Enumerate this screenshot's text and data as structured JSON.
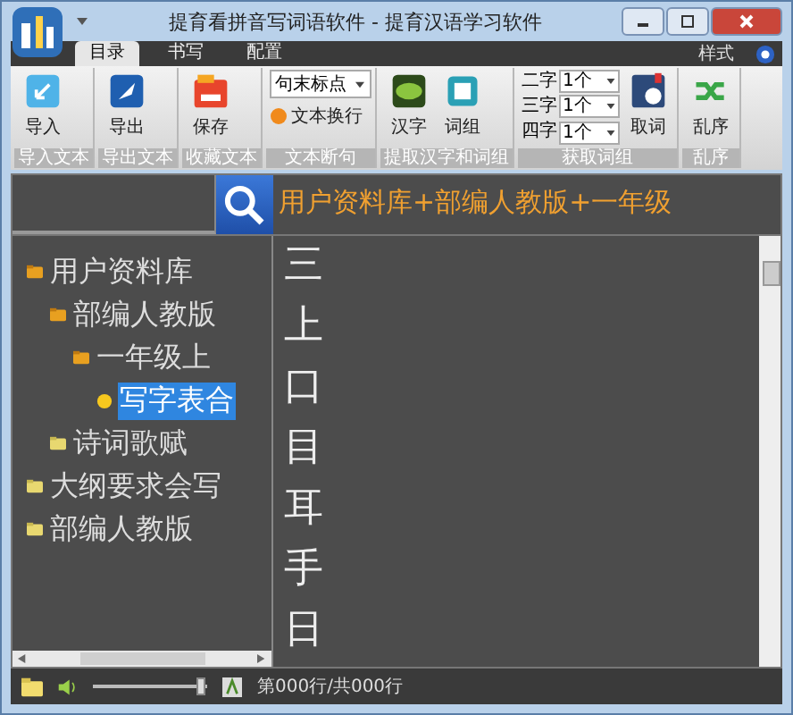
{
  "window": {
    "title": "提育看拼音写词语软件 - 提育汉语学习软件",
    "style_menu": "样式"
  },
  "tabs": [
    {
      "label": "目录",
      "selected": true
    },
    {
      "label": "书写",
      "selected": false
    },
    {
      "label": "配置",
      "selected": false
    }
  ],
  "ribbon": [
    {
      "label": "导入文本",
      "items": [
        {
          "kind": "big",
          "label": "导入"
        }
      ]
    },
    {
      "label": "导出文本",
      "items": [
        {
          "kind": "big",
          "label": "导出"
        }
      ]
    },
    {
      "label": "收藏文本",
      "items": [
        {
          "kind": "big",
          "label": "保存"
        }
      ]
    },
    {
      "label": "文本断句",
      "items": [
        {
          "kind": "dropdown",
          "label": "句末标点"
        },
        {
          "kind": "small",
          "label": "文本换行"
        }
      ]
    },
    {
      "label": "提取汉字和词组",
      "items": [
        {
          "kind": "big",
          "label": "汉字"
        },
        {
          "kind": "big",
          "label": "词组"
        }
      ]
    },
    {
      "label": "获取词组",
      "items": [
        {
          "kind": "count",
          "label": "二字",
          "value": "1个"
        },
        {
          "kind": "count",
          "label": "三字",
          "value": "1个"
        },
        {
          "kind": "count",
          "label": "四字",
          "value": "1个"
        },
        {
          "kind": "big",
          "label": "取词"
        }
      ]
    },
    {
      "label": "乱序",
      "items": [
        {
          "kind": "big",
          "label": "乱序"
        }
      ]
    }
  ],
  "search": {
    "path": "用户资料库+部编人教版+一年级"
  },
  "tree": [
    {
      "label": "用户资料库",
      "kind": "folder",
      "expanded": true,
      "selected": false,
      "children": [
        {
          "label": "部编人教版",
          "kind": "folder",
          "expanded": true,
          "selected": false,
          "children": [
            {
              "label": "一年级上",
              "kind": "folder",
              "expanded": true,
              "selected": false,
              "children": [
                {
                  "label": "写字表合",
                  "kind": "item",
                  "selected": true
                }
              ]
            }
          ]
        },
        {
          "label": "诗词歌赋",
          "kind": "folder",
          "expanded": false,
          "selected": false
        }
      ]
    },
    {
      "label": "大纲要求会写",
      "kind": "folder",
      "expanded": false,
      "selected": false
    },
    {
      "label": "部编人教版",
      "kind": "folder",
      "expanded": false,
      "selected": false
    }
  ],
  "characters": [
    "三",
    "上",
    "口",
    "目",
    "耳",
    "手",
    "日"
  ],
  "status_bar": {
    "volume": {
      "level": 1
    },
    "position": "第000行/共000行"
  }
}
